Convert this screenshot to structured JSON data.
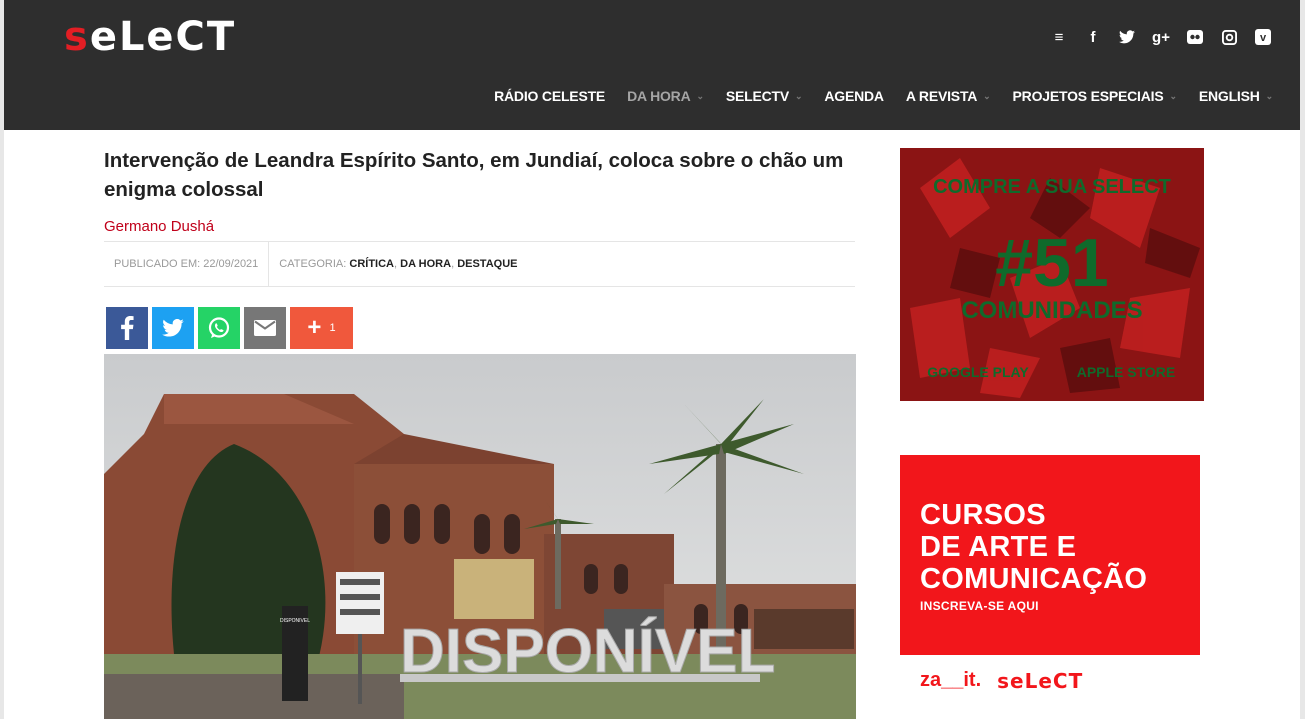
{
  "brand": {
    "logo_s": "s",
    "logo_rest": "eLeCT"
  },
  "social": [
    {
      "name": "rss-icon",
      "glyph": "≡"
    },
    {
      "name": "facebook-icon",
      "glyph": "f"
    },
    {
      "name": "twitter-icon",
      "glyph": "✦"
    },
    {
      "name": "google-plus-icon",
      "glyph": "g+"
    },
    {
      "name": "flickr-icon",
      "glyph": "●●"
    },
    {
      "name": "instagram-icon",
      "glyph": "▣"
    },
    {
      "name": "vimeo-icon",
      "glyph": "v"
    }
  ],
  "nav": [
    {
      "label": "RÁDIO CELESTE",
      "dropdown": false,
      "active": false
    },
    {
      "label": "DA HORA",
      "dropdown": true,
      "active": true
    },
    {
      "label": "SELECTV",
      "dropdown": true,
      "active": false
    },
    {
      "label": "AGENDA",
      "dropdown": false,
      "active": false
    },
    {
      "label": "A REVISTA",
      "dropdown": true,
      "active": false
    },
    {
      "label": "PROJETOS ESPECIAIS",
      "dropdown": true,
      "active": false
    },
    {
      "label": "ENGLISH",
      "dropdown": true,
      "active": false
    }
  ],
  "article": {
    "title": "Intervenção de Leandra Espírito Santo, em Jundiaí, coloca sobre o chão um enigma colossal",
    "author": "Germano Dushá",
    "published": "PUBLICADO EM: 22/09/2021",
    "category_label": "CATEGORIA:",
    "categories": [
      "CRÍTICA",
      "DA HORA",
      "DESTAQUE"
    ],
    "share_count": "1",
    "photo_text": "DISPONÍVEL",
    "photo_small": "DISPONIVEL"
  },
  "ads": {
    "magazine": {
      "line1": "COMPRE A SUA SELECT",
      "issue": "#51",
      "theme": "COMUNIDADES",
      "store1": "GOOGLE PLAY",
      "store2": "APPLE STORE"
    },
    "courses": {
      "line1": "CURSOS",
      "line2": "DE ARTE E",
      "line3": "COMUNICAÇÃO",
      "cta": "INSCREVA-SE AQUI",
      "partner": "za__it.",
      "brand": "seLeCT"
    }
  },
  "colors": {
    "header_bg": "#2e2e2e",
    "accent_red": "#e31e24",
    "author_red": "#c0001a"
  }
}
